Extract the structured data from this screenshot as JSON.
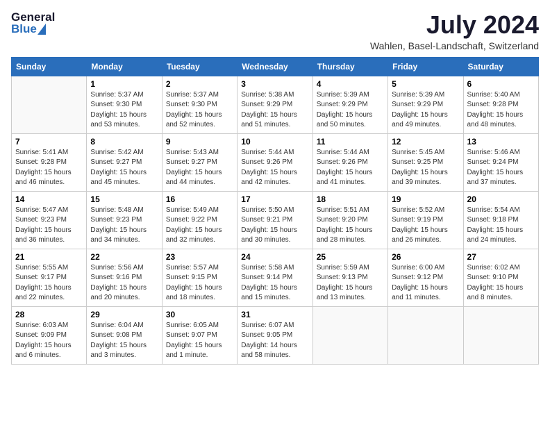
{
  "header": {
    "logo_general": "General",
    "logo_blue": "Blue",
    "month_title": "July 2024",
    "location": "Wahlen, Basel-Landschaft, Switzerland"
  },
  "days_of_week": [
    "Sunday",
    "Monday",
    "Tuesday",
    "Wednesday",
    "Thursday",
    "Friday",
    "Saturday"
  ],
  "weeks": [
    [
      {
        "day": "",
        "sunrise": "",
        "sunset": "",
        "daylight": ""
      },
      {
        "day": "1",
        "sunrise": "Sunrise: 5:37 AM",
        "sunset": "Sunset: 9:30 PM",
        "daylight": "Daylight: 15 hours and 53 minutes."
      },
      {
        "day": "2",
        "sunrise": "Sunrise: 5:37 AM",
        "sunset": "Sunset: 9:30 PM",
        "daylight": "Daylight: 15 hours and 52 minutes."
      },
      {
        "day": "3",
        "sunrise": "Sunrise: 5:38 AM",
        "sunset": "Sunset: 9:29 PM",
        "daylight": "Daylight: 15 hours and 51 minutes."
      },
      {
        "day": "4",
        "sunrise": "Sunrise: 5:39 AM",
        "sunset": "Sunset: 9:29 PM",
        "daylight": "Daylight: 15 hours and 50 minutes."
      },
      {
        "day": "5",
        "sunrise": "Sunrise: 5:39 AM",
        "sunset": "Sunset: 9:29 PM",
        "daylight": "Daylight: 15 hours and 49 minutes."
      },
      {
        "day": "6",
        "sunrise": "Sunrise: 5:40 AM",
        "sunset": "Sunset: 9:28 PM",
        "daylight": "Daylight: 15 hours and 48 minutes."
      }
    ],
    [
      {
        "day": "7",
        "sunrise": "Sunrise: 5:41 AM",
        "sunset": "Sunset: 9:28 PM",
        "daylight": "Daylight: 15 hours and 46 minutes."
      },
      {
        "day": "8",
        "sunrise": "Sunrise: 5:42 AM",
        "sunset": "Sunset: 9:27 PM",
        "daylight": "Daylight: 15 hours and 45 minutes."
      },
      {
        "day": "9",
        "sunrise": "Sunrise: 5:43 AM",
        "sunset": "Sunset: 9:27 PM",
        "daylight": "Daylight: 15 hours and 44 minutes."
      },
      {
        "day": "10",
        "sunrise": "Sunrise: 5:44 AM",
        "sunset": "Sunset: 9:26 PM",
        "daylight": "Daylight: 15 hours and 42 minutes."
      },
      {
        "day": "11",
        "sunrise": "Sunrise: 5:44 AM",
        "sunset": "Sunset: 9:26 PM",
        "daylight": "Daylight: 15 hours and 41 minutes."
      },
      {
        "day": "12",
        "sunrise": "Sunrise: 5:45 AM",
        "sunset": "Sunset: 9:25 PM",
        "daylight": "Daylight: 15 hours and 39 minutes."
      },
      {
        "day": "13",
        "sunrise": "Sunrise: 5:46 AM",
        "sunset": "Sunset: 9:24 PM",
        "daylight": "Daylight: 15 hours and 37 minutes."
      }
    ],
    [
      {
        "day": "14",
        "sunrise": "Sunrise: 5:47 AM",
        "sunset": "Sunset: 9:23 PM",
        "daylight": "Daylight: 15 hours and 36 minutes."
      },
      {
        "day": "15",
        "sunrise": "Sunrise: 5:48 AM",
        "sunset": "Sunset: 9:23 PM",
        "daylight": "Daylight: 15 hours and 34 minutes."
      },
      {
        "day": "16",
        "sunrise": "Sunrise: 5:49 AM",
        "sunset": "Sunset: 9:22 PM",
        "daylight": "Daylight: 15 hours and 32 minutes."
      },
      {
        "day": "17",
        "sunrise": "Sunrise: 5:50 AM",
        "sunset": "Sunset: 9:21 PM",
        "daylight": "Daylight: 15 hours and 30 minutes."
      },
      {
        "day": "18",
        "sunrise": "Sunrise: 5:51 AM",
        "sunset": "Sunset: 9:20 PM",
        "daylight": "Daylight: 15 hours and 28 minutes."
      },
      {
        "day": "19",
        "sunrise": "Sunrise: 5:52 AM",
        "sunset": "Sunset: 9:19 PM",
        "daylight": "Daylight: 15 hours and 26 minutes."
      },
      {
        "day": "20",
        "sunrise": "Sunrise: 5:54 AM",
        "sunset": "Sunset: 9:18 PM",
        "daylight": "Daylight: 15 hours and 24 minutes."
      }
    ],
    [
      {
        "day": "21",
        "sunrise": "Sunrise: 5:55 AM",
        "sunset": "Sunset: 9:17 PM",
        "daylight": "Daylight: 15 hours and 22 minutes."
      },
      {
        "day": "22",
        "sunrise": "Sunrise: 5:56 AM",
        "sunset": "Sunset: 9:16 PM",
        "daylight": "Daylight: 15 hours and 20 minutes."
      },
      {
        "day": "23",
        "sunrise": "Sunrise: 5:57 AM",
        "sunset": "Sunset: 9:15 PM",
        "daylight": "Daylight: 15 hours and 18 minutes."
      },
      {
        "day": "24",
        "sunrise": "Sunrise: 5:58 AM",
        "sunset": "Sunset: 9:14 PM",
        "daylight": "Daylight: 15 hours and 15 minutes."
      },
      {
        "day": "25",
        "sunrise": "Sunrise: 5:59 AM",
        "sunset": "Sunset: 9:13 PM",
        "daylight": "Daylight: 15 hours and 13 minutes."
      },
      {
        "day": "26",
        "sunrise": "Sunrise: 6:00 AM",
        "sunset": "Sunset: 9:12 PM",
        "daylight": "Daylight: 15 hours and 11 minutes."
      },
      {
        "day": "27",
        "sunrise": "Sunrise: 6:02 AM",
        "sunset": "Sunset: 9:10 PM",
        "daylight": "Daylight: 15 hours and 8 minutes."
      }
    ],
    [
      {
        "day": "28",
        "sunrise": "Sunrise: 6:03 AM",
        "sunset": "Sunset: 9:09 PM",
        "daylight": "Daylight: 15 hours and 6 minutes."
      },
      {
        "day": "29",
        "sunrise": "Sunrise: 6:04 AM",
        "sunset": "Sunset: 9:08 PM",
        "daylight": "Daylight: 15 hours and 3 minutes."
      },
      {
        "day": "30",
        "sunrise": "Sunrise: 6:05 AM",
        "sunset": "Sunset: 9:07 PM",
        "daylight": "Daylight: 15 hours and 1 minute."
      },
      {
        "day": "31",
        "sunrise": "Sunrise: 6:07 AM",
        "sunset": "Sunset: 9:05 PM",
        "daylight": "Daylight: 14 hours and 58 minutes."
      },
      {
        "day": "",
        "sunrise": "",
        "sunset": "",
        "daylight": ""
      },
      {
        "day": "",
        "sunrise": "",
        "sunset": "",
        "daylight": ""
      },
      {
        "day": "",
        "sunrise": "",
        "sunset": "",
        "daylight": ""
      }
    ]
  ]
}
